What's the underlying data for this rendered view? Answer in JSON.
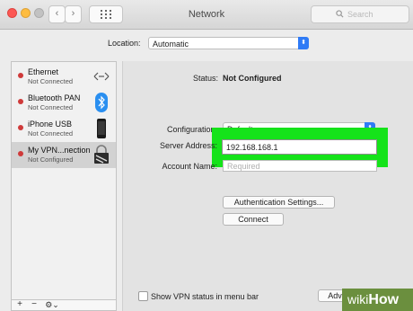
{
  "window": {
    "title": "Network",
    "search_placeholder": "Search",
    "back_glyph": "‹",
    "forward_glyph": "›",
    "traffic_colors": {
      "close": "#fc5753",
      "minimize": "#fdbc40",
      "zoom": "#b9b9b9"
    }
  },
  "location": {
    "label": "Location:",
    "value": "Automatic"
  },
  "sidebar": {
    "services": [
      {
        "name": "Ethernet",
        "status": "Not Connected",
        "status_color": "#cf3a3a",
        "icon": "ethernet-icon"
      },
      {
        "name": "Bluetooth PAN",
        "status": "Not Connected",
        "status_color": "#cf3a3a",
        "icon": "bluetooth-icon"
      },
      {
        "name": "iPhone USB",
        "status": "Not Connected",
        "status_color": "#cf3a3a",
        "icon": "iphone-icon"
      },
      {
        "name": "My VPN...nection",
        "status": "Not Configured",
        "status_color": "#cf3a3a",
        "icon": "vpn-lock-icon"
      }
    ],
    "buttons": {
      "add": "+",
      "remove": "−",
      "gear": "⚙⌄"
    }
  },
  "detail": {
    "status_label": "Status:",
    "status_value": "Not Configured",
    "configuration_label": "Configuration:",
    "configuration_value": "Default",
    "server_address_label": "Server Address:",
    "server_address_value": "192.168.168.1",
    "account_name_label": "Account Name:",
    "account_name_placeholder": "Required",
    "auth_button": "Authentication Settings...",
    "connect_button": "Connect",
    "show_vpn_label": "Show VPN status in menu bar",
    "advanced_button": "Advanced..."
  },
  "highlight_color": "#15e31a",
  "watermark": {
    "wiki": "wiki",
    "how": "How"
  }
}
